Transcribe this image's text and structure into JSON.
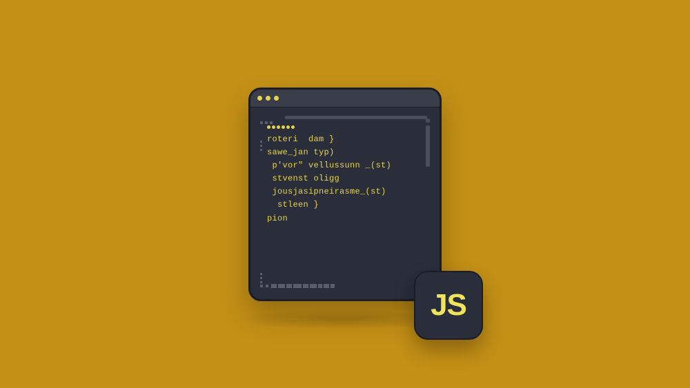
{
  "editor": {
    "code_lines": [
      "roteri  dam }",
      "sawe_jan typ)",
      " p'vor\" vellussunn _(st)",
      " stvenst oligg",
      " jousjasipneirasme_(st)",
      "  stleen }",
      "pion"
    ]
  },
  "badge": {
    "label": "JS"
  }
}
